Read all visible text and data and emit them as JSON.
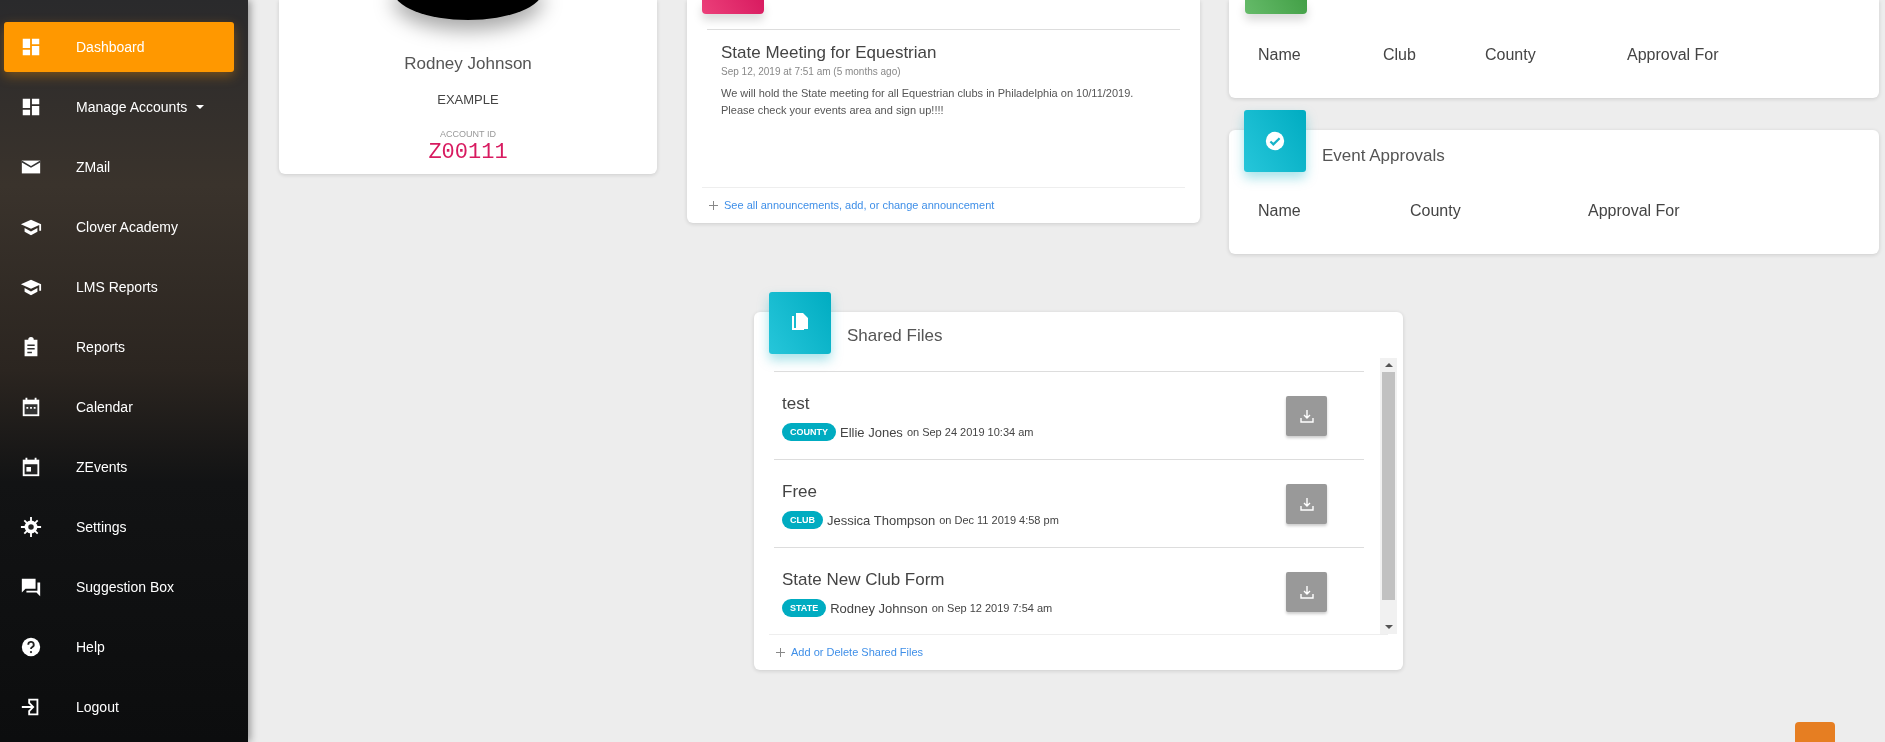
{
  "sidebar": {
    "items": [
      {
        "label": "Dashboard",
        "selected": true,
        "has_submenu": false
      },
      {
        "label": "Manage Accounts",
        "selected": false,
        "has_submenu": true
      },
      {
        "label": "ZMail",
        "selected": false,
        "has_submenu": false
      },
      {
        "label": "Clover Academy",
        "selected": false,
        "has_submenu": false
      },
      {
        "label": "LMS Reports",
        "selected": false,
        "has_submenu": false
      },
      {
        "label": "Reports",
        "selected": false,
        "has_submenu": false
      },
      {
        "label": "Calendar",
        "selected": false,
        "has_submenu": false
      },
      {
        "label": "ZEvents",
        "selected": false,
        "has_submenu": false
      },
      {
        "label": "Settings",
        "selected": false,
        "has_submenu": false
      },
      {
        "label": "Suggestion Box",
        "selected": false,
        "has_submenu": false
      },
      {
        "label": "Help",
        "selected": false,
        "has_submenu": false
      },
      {
        "label": "Logout",
        "selected": false,
        "has_submenu": false
      }
    ]
  },
  "profile": {
    "name": "Rodney Johnson",
    "role": "EXAMPLE",
    "account_id_label": "ACCOUNT ID",
    "account_id": "Z00111"
  },
  "announcements": {
    "items": [
      {
        "title": "State Meeting for Equestrian",
        "date": "Sep 12, 2019 at 7:51 am (5 months ago)",
        "body": "We will hold the State meeting for all Equestrian clubs in Philadelphia on 10/11/2019. Please check your events area and sign up!!!!"
      }
    ],
    "link": "See all announcements, add, or change announcement"
  },
  "approvals": {
    "columns": [
      "Name",
      "Club",
      "County",
      "Approval For"
    ]
  },
  "event_approvals": {
    "title": "Event Approvals",
    "columns": [
      "Name",
      "County",
      "Approval For"
    ]
  },
  "shared_files": {
    "title": "Shared Files",
    "files": [
      {
        "name": "test",
        "tag": "COUNTY",
        "author": "Ellie Jones",
        "date": "on Sep 24 2019 10:34 am"
      },
      {
        "name": "Free",
        "tag": "CLUB",
        "author": "Jessica Thompson",
        "date": "on Dec 11 2019 4:58 pm"
      },
      {
        "name": "State New Club Form",
        "tag": "STATE",
        "author": "Rodney Johnson",
        "date": "on Sep 12 2019 7:54 am"
      }
    ],
    "link": "Add or Delete Shared Files"
  }
}
